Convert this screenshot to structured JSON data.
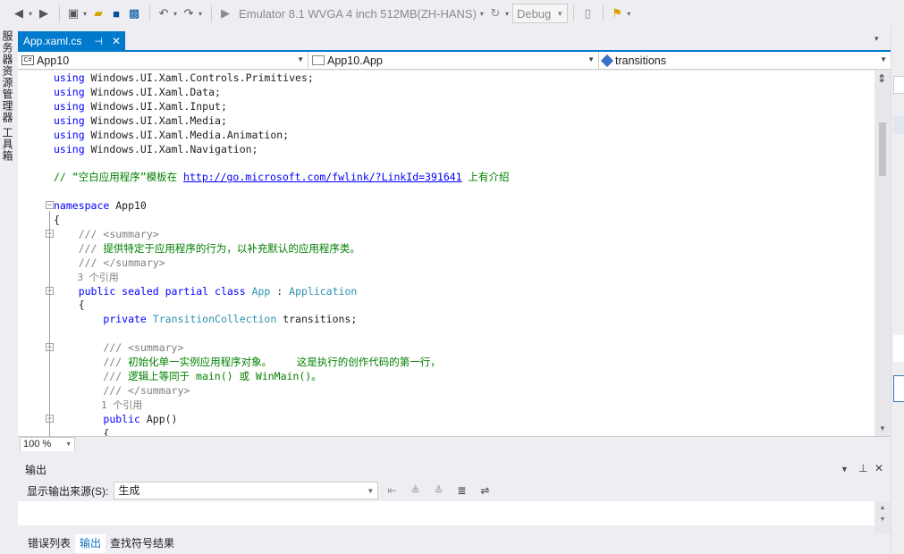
{
  "toolbar": {
    "run_target": "Emulator 8.1 WVGA 4 inch 512MB(ZH-HANS)",
    "configuration": "Debug"
  },
  "left_strip": {
    "items": [
      "服务器资源管理器",
      "工具箱"
    ]
  },
  "document_tab": {
    "title": "App.xaml.cs"
  },
  "navigation_bar": {
    "project": "App10",
    "class": "App10.App",
    "member": "transitions"
  },
  "editor": {
    "lines": [
      {
        "parts": [
          {
            "t": "using",
            "c": "kw"
          },
          {
            "t": " Windows.UI.Xaml.Controls.Primitives;",
            "c": ""
          }
        ]
      },
      {
        "parts": [
          {
            "t": "using",
            "c": "kw"
          },
          {
            "t": " Windows.UI.Xaml.Data;",
            "c": ""
          }
        ]
      },
      {
        "parts": [
          {
            "t": "using",
            "c": "kw"
          },
          {
            "t": " Windows.UI.Xaml.Input;",
            "c": ""
          }
        ]
      },
      {
        "parts": [
          {
            "t": "using",
            "c": "kw"
          },
          {
            "t": " Windows.UI.Xaml.Media;",
            "c": ""
          }
        ]
      },
      {
        "parts": [
          {
            "t": "using",
            "c": "kw"
          },
          {
            "t": " Windows.UI.Xaml.Media.Animation;",
            "c": ""
          }
        ]
      },
      {
        "parts": [
          {
            "t": "using",
            "c": "kw"
          },
          {
            "t": " Windows.UI.Xaml.Navigation;",
            "c": ""
          }
        ]
      },
      {
        "parts": []
      },
      {
        "parts": [
          {
            "t": "// “空白应用程序”模板在 ",
            "c": "cm"
          },
          {
            "t": "http://go.microsoft.com/fwlink/?LinkId=391641",
            "c": "lnk"
          },
          {
            "t": " 上有介绍",
            "c": "cm"
          }
        ]
      },
      {
        "parts": []
      },
      {
        "parts": [
          {
            "t": "namespace",
            "c": "kw"
          },
          {
            "t": " App10",
            "c": ""
          }
        ]
      },
      {
        "parts": [
          {
            "t": "{",
            "c": ""
          }
        ]
      },
      {
        "parts": [
          {
            "t": "    /// ",
            "c": "cmg"
          },
          {
            "t": "<summary>",
            "c": "cmg"
          }
        ]
      },
      {
        "parts": [
          {
            "t": "    /// ",
            "c": "cmg"
          },
          {
            "t": "提供特定于应用程序的行为，以补充默认的应用程序类。",
            "c": "cm"
          }
        ]
      },
      {
        "parts": [
          {
            "t": "    /// ",
            "c": "cmg"
          },
          {
            "t": "</summary>",
            "c": "cmg"
          }
        ]
      },
      {
        "parts": [
          {
            "t": "    3 个引用",
            "c": "ref"
          }
        ]
      },
      {
        "parts": [
          {
            "t": "    ",
            "c": ""
          },
          {
            "t": "public sealed partial class",
            "c": "kw"
          },
          {
            "t": " ",
            "c": ""
          },
          {
            "t": "App",
            "c": "tp"
          },
          {
            "t": " : ",
            "c": ""
          },
          {
            "t": "Application",
            "c": "tp"
          }
        ]
      },
      {
        "parts": [
          {
            "t": "    {",
            "c": ""
          }
        ]
      },
      {
        "parts": [
          {
            "t": "        ",
            "c": ""
          },
          {
            "t": "private",
            "c": "kw"
          },
          {
            "t": " ",
            "c": ""
          },
          {
            "t": "TransitionCollection",
            "c": "tp"
          },
          {
            "t": " transitions;",
            "c": ""
          }
        ]
      },
      {
        "parts": []
      },
      {
        "parts": [
          {
            "t": "        /// ",
            "c": "cmg"
          },
          {
            "t": "<summary>",
            "c": "cmg"
          }
        ]
      },
      {
        "parts": [
          {
            "t": "        /// ",
            "c": "cmg"
          },
          {
            "t": "初始化单一实例应用程序对象。    这是执行的创作代码的第一行，",
            "c": "cm"
          }
        ]
      },
      {
        "parts": [
          {
            "t": "        /// ",
            "c": "cmg"
          },
          {
            "t": "逻辑上等同于 main() 或 WinMain()。",
            "c": "cm"
          }
        ]
      },
      {
        "parts": [
          {
            "t": "        /// ",
            "c": "cmg"
          },
          {
            "t": "</summary>",
            "c": "cmg"
          }
        ]
      },
      {
        "parts": [
          {
            "t": "        1 个引用",
            "c": "ref"
          }
        ]
      },
      {
        "parts": [
          {
            "t": "        ",
            "c": ""
          },
          {
            "t": "public",
            "c": "kw"
          },
          {
            "t": " App()",
            "c": ""
          }
        ]
      },
      {
        "parts": [
          {
            "t": "        {",
            "c": ""
          }
        ]
      }
    ]
  },
  "zoom": {
    "level": "100 %"
  },
  "output": {
    "title": "输出",
    "source_label": "显示输出来源(S):",
    "source_value": "生成"
  },
  "bottom_tabs": [
    "错误列表",
    "输出",
    "查找符号结果"
  ]
}
